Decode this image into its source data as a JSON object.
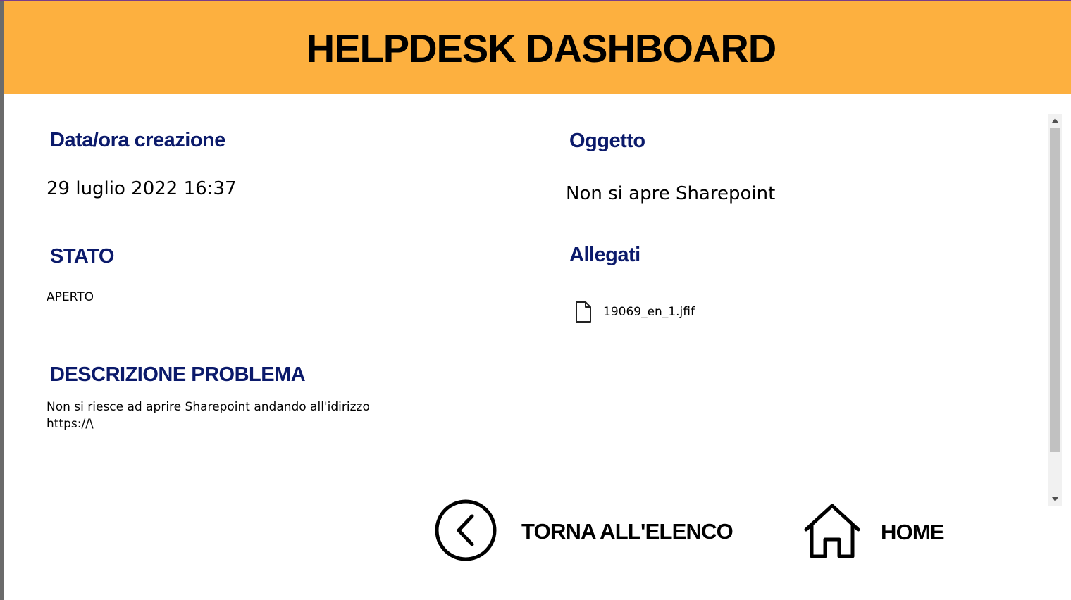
{
  "header": {
    "title": "HELPDESK DASHBOARD"
  },
  "fields": {
    "created_label": "Data/ora creazione",
    "created_value": "29 luglio 2022 16:37",
    "subject_label": "Oggetto",
    "subject_value": "Non si apre Sharepoint",
    "status_label": "STATO",
    "status_value": "APERTO",
    "attachments_label": "Allegati",
    "attachments": [
      {
        "name": "19069_en_1.jfif",
        "icon": "file-icon"
      }
    ],
    "description_label": "DESCRIZIONE PROBLEMA",
    "description_line1": "Non si riesce ad aprire Sharepoint andando all'idirizzo",
    "description_line2": "https://\\"
  },
  "nav": {
    "back_label": "TORNA ALL'ELENCO",
    "back_icon": "chevron-left-circle-icon",
    "home_label": "HOME",
    "home_icon": "home-icon"
  },
  "colors": {
    "header_bg": "#fdb03f",
    "label_color": "#0b1a6b",
    "top_line": "#7a3e8a"
  }
}
